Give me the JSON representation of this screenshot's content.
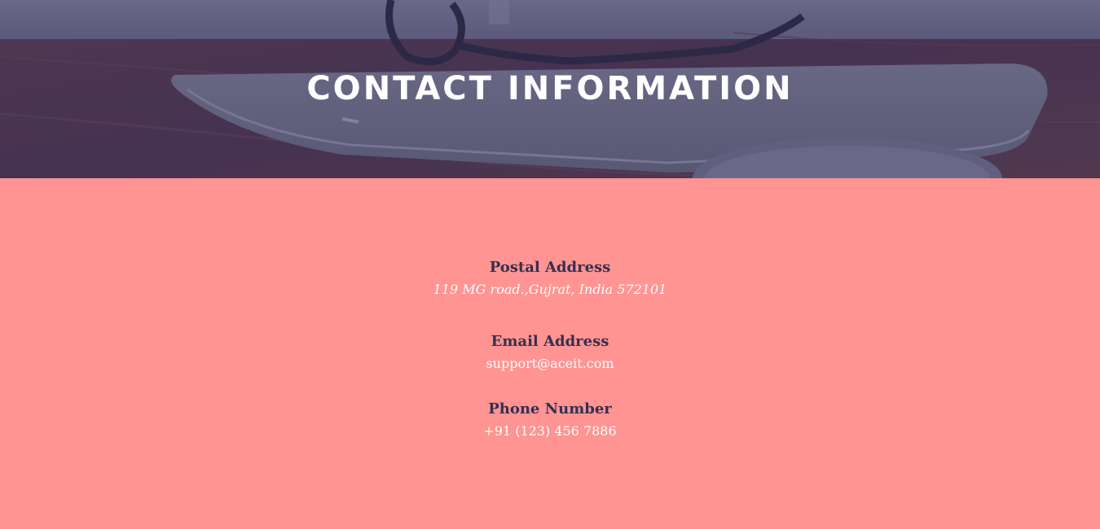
{
  "hero": {
    "title": "CONTACT INFORMATION"
  },
  "contact": {
    "postal": {
      "label": "Postal Address",
      "value": "119 MG road.,Gujrat, India 572101"
    },
    "email": {
      "label": "Email Address",
      "value": "support@aceit.com"
    },
    "phone": {
      "label": "Phone Number",
      "value": "+91 (123) 456 7886"
    }
  },
  "colors": {
    "section_background": "#ff9492",
    "label_text": "#34304f",
    "value_text": "#ffffff",
    "hero_overlay": "#3a3a5c"
  }
}
